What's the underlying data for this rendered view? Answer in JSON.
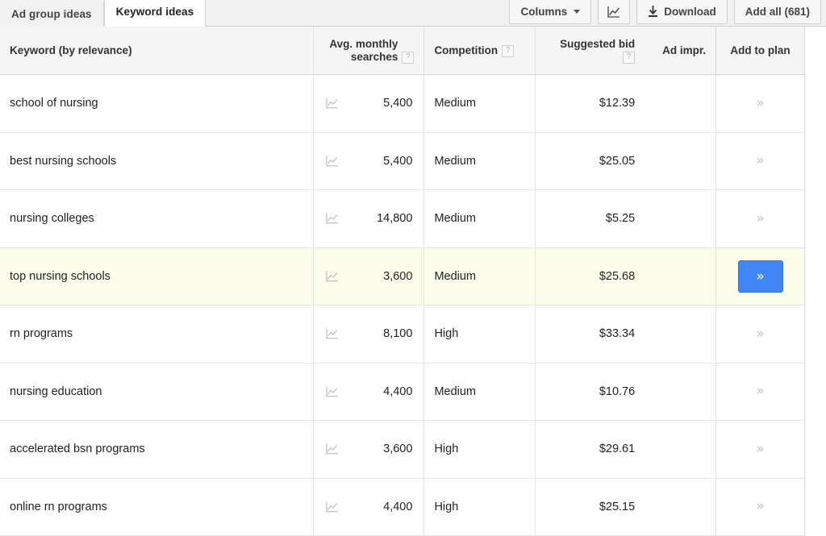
{
  "tabs": [
    {
      "label": "Ad group ideas",
      "active": false,
      "name": "tab-ad-group-ideas"
    },
    {
      "label": "Keyword ideas",
      "active": true,
      "name": "tab-keyword-ideas"
    }
  ],
  "toolbar": {
    "columns_label": "Columns",
    "chart_icon": "line-chart-icon",
    "download_label": "Download",
    "download_icon": "download-icon",
    "add_all_label": "Add all (681)"
  },
  "table": {
    "columns": [
      {
        "key": "keyword",
        "label": "Keyword (by relevance)",
        "help": false
      },
      {
        "key": "searches",
        "label": "Avg. monthly searches",
        "help": true,
        "help_glyph": "?"
      },
      {
        "key": "comp",
        "label": "Competition",
        "help": true,
        "help_glyph": "?"
      },
      {
        "key": "bid",
        "label": "Suggested bid",
        "help": true,
        "help_glyph": "?"
      },
      {
        "key": "impr",
        "label": "Ad impr.",
        "help": false
      },
      {
        "key": "plan",
        "label": "Add to plan",
        "help": false
      }
    ],
    "add_chevron": "»",
    "rows": [
      {
        "keyword": "school of nursing",
        "searches": "5,400",
        "comp": "Medium",
        "bid": "$12.39",
        "impr": "",
        "selected": false,
        "trend_icon": "trend-chart-icon"
      },
      {
        "keyword": "best nursing schools",
        "searches": "5,400",
        "comp": "Medium",
        "bid": "$25.05",
        "impr": "",
        "selected": false,
        "trend_icon": "trend-chart-icon"
      },
      {
        "keyword": "nursing colleges",
        "searches": "14,800",
        "comp": "Medium",
        "bid": "$5.25",
        "impr": "",
        "selected": false,
        "trend_icon": "trend-chart-icon"
      },
      {
        "keyword": "top nursing schools",
        "searches": "3,600",
        "comp": "Medium",
        "bid": "$25.68",
        "impr": "",
        "selected": true,
        "trend_icon": "trend-chart-icon"
      },
      {
        "keyword": "rn programs",
        "searches": "8,100",
        "comp": "High",
        "bid": "$33.34",
        "impr": "",
        "selected": false,
        "trend_icon": "trend-chart-icon"
      },
      {
        "keyword": "nursing education",
        "searches": "4,400",
        "comp": "Medium",
        "bid": "$10.76",
        "impr": "",
        "selected": false,
        "trend_icon": "trend-chart-icon"
      },
      {
        "keyword": "accelerated bsn programs",
        "searches": "3,600",
        "comp": "High",
        "bid": "$29.61",
        "impr": "",
        "selected": false,
        "trend_icon": "trend-chart-icon"
      },
      {
        "keyword": "online rn programs",
        "searches": "4,400",
        "comp": "High",
        "bid": "$25.15",
        "impr": "",
        "selected": false,
        "trend_icon": "trend-chart-icon"
      }
    ]
  },
  "colors": {
    "accent": "#4285f4",
    "row_highlight": "#fdfdec",
    "header_bg": "#f5f5f5",
    "topbar_bg": "#f1f1f1"
  }
}
